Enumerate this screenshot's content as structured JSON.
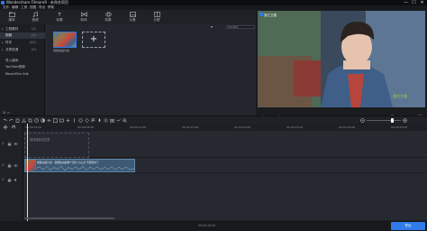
{
  "window": {
    "title": "Wondershare Filmora9 - 未命名项目",
    "min_glyph": "—",
    "max_glyph": "☐",
    "close_glyph": "✕"
  },
  "menu": {
    "items": [
      "文件",
      "编辑",
      "工具",
      "视图",
      "导出",
      "帮助"
    ]
  },
  "toolbar": {
    "items": [
      {
        "label": "媒体"
      },
      {
        "label": "音频"
      },
      {
        "label": "标题"
      },
      {
        "label": "转场"
      },
      {
        "label": "效果"
      },
      {
        "label": "元素"
      },
      {
        "label": "分屏"
      }
    ]
  },
  "sidebar": {
    "items": [
      {
        "label": "工程素材",
        "count": "(1)"
      },
      {
        "label": "视频",
        "count": "(1)"
      },
      {
        "label": "样本",
        "count": "(20)"
      },
      {
        "label": "共享资源",
        "count": "(0)"
      },
      {
        "label": "导入媒体",
        "count": ""
      },
      {
        "label": "YouTube视频",
        "count": ""
      },
      {
        "label": "MovieFilm Sdk",
        "count": ""
      }
    ],
    "footer": "⊞ ▭"
  },
  "media": {
    "dropdown": "▾",
    "search_placeholder": "搜索媒体",
    "clip_name": "视频动画片段",
    "import_glyph": "+"
  },
  "preview": {
    "watermark_left": "浙江卫视",
    "watermark_right": "我的主播",
    "timecode": "00:00:00:00",
    "fit": "1/2"
  },
  "timeline": {
    "ruler_labels": [
      "00:00:00:00",
      "00:00:05:00",
      "00:00:10:00",
      "00:00:15:00",
      "00:00:20:00",
      "00:00:25:00",
      "00:00:30:00",
      "00:00:35:00"
    ],
    "drop_hint": "拖放媒体到这里",
    "clip_label": "视频动画片段 - 我要快进的那个部分 小心点 不要剪掉了",
    "tracks": [
      "1",
      "1",
      "1"
    ]
  },
  "status": {
    "duration": "00:00:24:20",
    "export_label": "导出"
  },
  "colors": {
    "accent": "#2f7be8",
    "clip": "#3d5a74"
  }
}
